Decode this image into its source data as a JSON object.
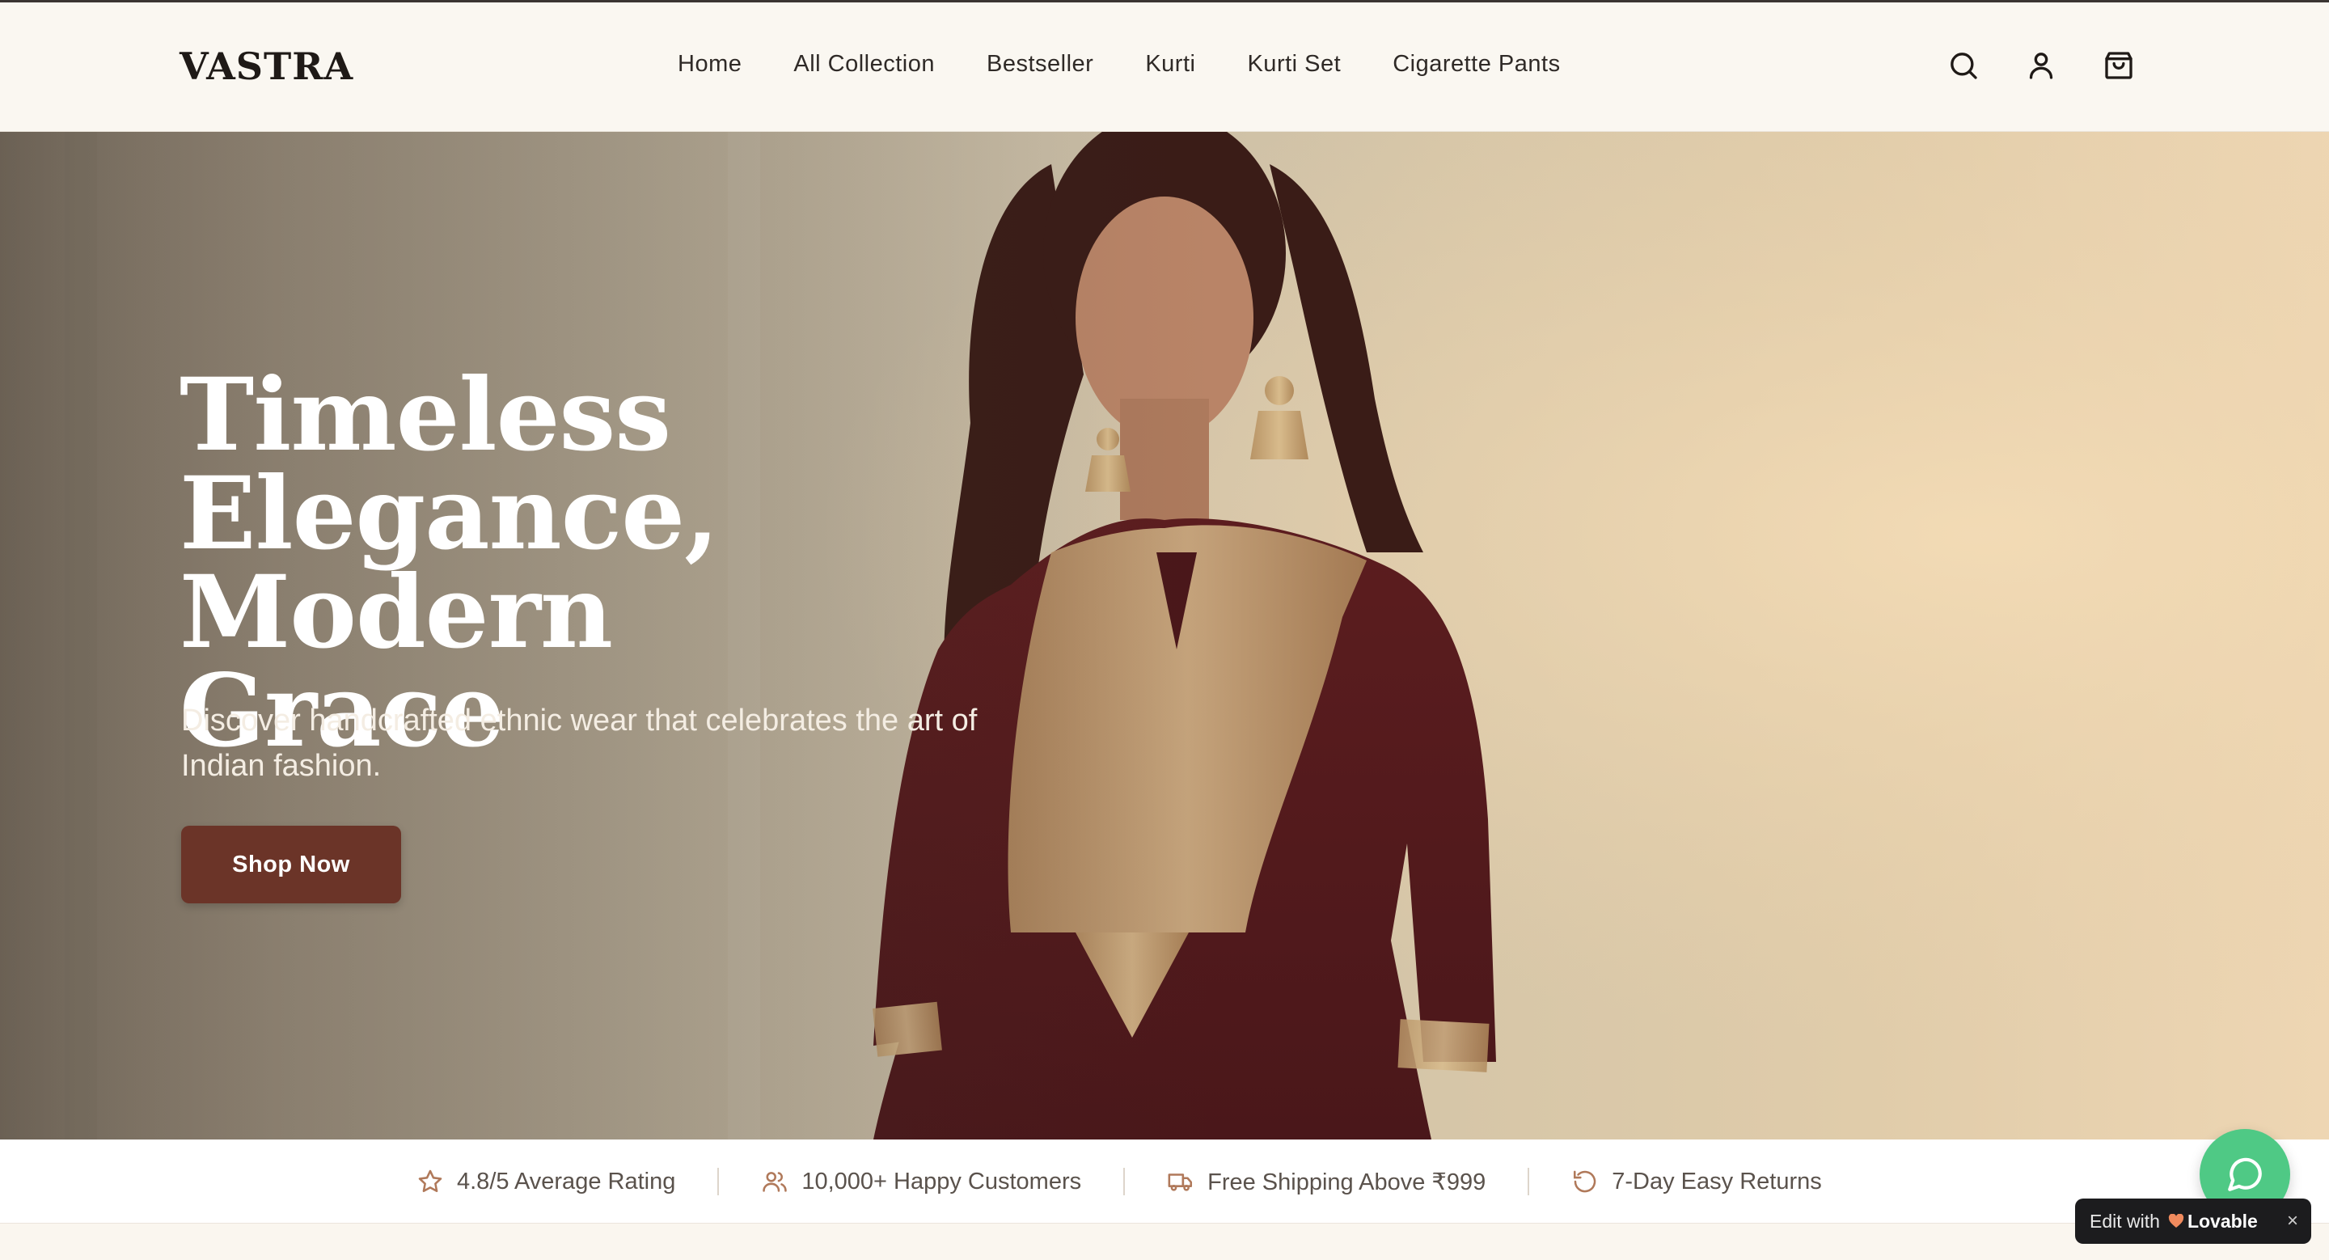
{
  "header": {
    "logo": "VASTRA",
    "nav": [
      {
        "label": "Home"
      },
      {
        "label": "All Collection"
      },
      {
        "label": "Bestseller"
      },
      {
        "label": "Kurti"
      },
      {
        "label": "Kurti Set"
      },
      {
        "label": "Cigarette Pants"
      }
    ],
    "icons": [
      "search-icon",
      "user-icon",
      "shopping-bag-icon"
    ]
  },
  "hero": {
    "title_line1": "Timeless",
    "title_line2": "Elegance, Modern",
    "title_line3": "Grace",
    "subtitle": "Discover handcrafted ethnic wear that celebrates the art of Indian fashion.",
    "cta_label": "Shop Now",
    "cta_color": "#6b3428"
  },
  "trust_bar": {
    "items": [
      {
        "icon": "star-icon",
        "label": "4.8/5 Average Rating"
      },
      {
        "icon": "users-icon",
        "label": "10,000+ Happy Customers"
      },
      {
        "icon": "truck-icon",
        "label": "Free Shipping Above ₹999"
      },
      {
        "icon": "rotate-ccw-icon",
        "label": "7-Day Easy Returns"
      }
    ]
  },
  "widgets": {
    "chat_icon": "message-circle-icon",
    "chat_color": "#4fc985",
    "lovable_prefix": "Edit with",
    "lovable_brand": "Lovable",
    "lovable_close": "×"
  }
}
